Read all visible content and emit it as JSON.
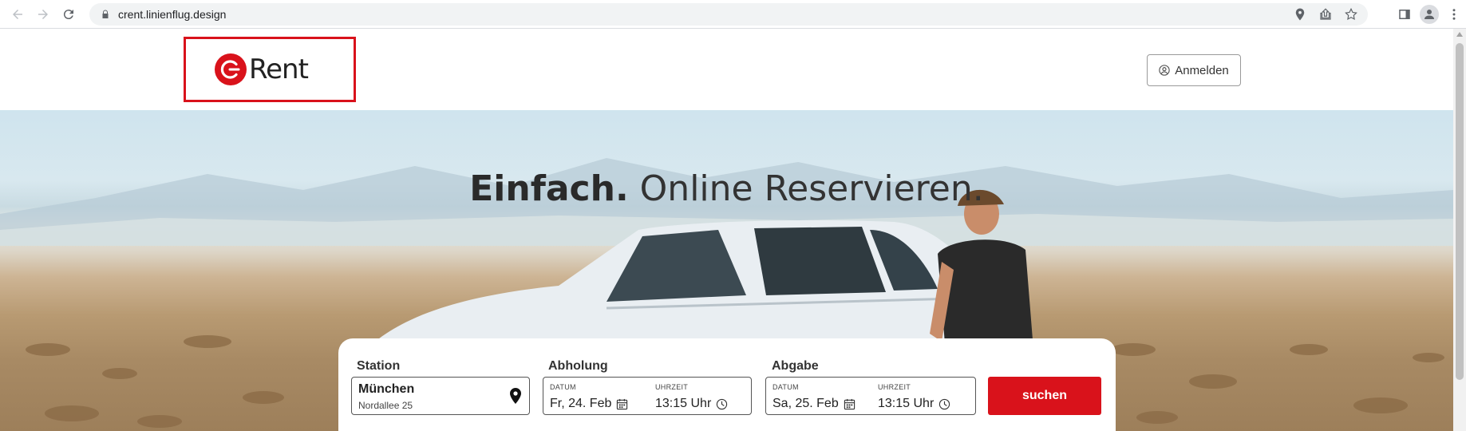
{
  "browser": {
    "url": "crent.linienflug.design"
  },
  "header": {
    "logo_text": "Rent",
    "login_label": "Anmelden"
  },
  "hero": {
    "title_strong": "Einfach.",
    "title_light": "Online Reservieren."
  },
  "search": {
    "station_label": "Station",
    "station_name": "München",
    "station_address": "Nordallee 25",
    "pickup_label": "Abholung",
    "pickup_date_label": "DATUM",
    "pickup_date": "Fr, 24. Feb",
    "pickup_time_label": "UHRZEIT",
    "pickup_time": "13:15 Uhr",
    "return_label": "Abgabe",
    "return_date_label": "DATUM",
    "return_date": "Sa, 25. Feb",
    "return_time_label": "UHRZEIT",
    "return_time": "13:15 Uhr",
    "search_button": "suchen"
  },
  "colors": {
    "brand_red": "#d9121b"
  }
}
